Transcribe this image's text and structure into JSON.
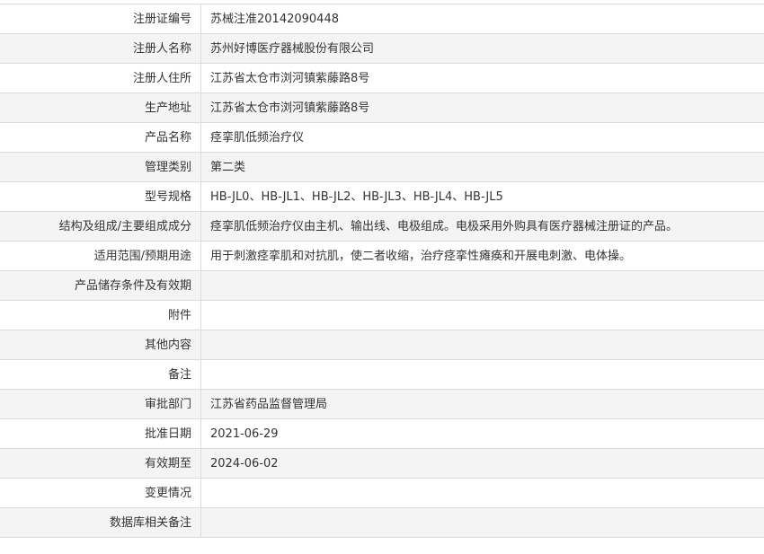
{
  "record": {
    "rows": [
      {
        "label": "注册证编号",
        "value": "苏械注准20142090448"
      },
      {
        "label": "注册人名称",
        "value": "苏州好博医疗器械股份有限公司"
      },
      {
        "label": "注册人住所",
        "value": "江苏省太仓市浏河镇紫藤路8号"
      },
      {
        "label": "生产地址",
        "value": "江苏省太仓市浏河镇紫藤路8号"
      },
      {
        "label": "产品名称",
        "value": "痉挛肌低频治疗仪"
      },
      {
        "label": "管理类别",
        "value": "第二类"
      },
      {
        "label": "型号规格",
        "value": "HB-JL0、HB-JL1、HB-JL2、HB-JL3、HB-JL4、HB-JL5"
      },
      {
        "label": "结构及组成/主要组成成分",
        "value": "痉挛肌低频治疗仪由主机、输出线、电极组成。电极采用外购具有医疗器械注册证的产品。"
      },
      {
        "label": "适用范围/预期用途",
        "value": "用于刺激痉挛肌和对抗肌，使二者收缩，治疗痉挛性瘫痪和开展电刺激、电体操。"
      },
      {
        "label": "产品储存条件及有效期",
        "value": ""
      },
      {
        "label": "附件",
        "value": ""
      },
      {
        "label": "其他内容",
        "value": ""
      },
      {
        "label": "备注",
        "value": ""
      },
      {
        "label": "审批部门",
        "value": "江苏省药品监督管理局"
      },
      {
        "label": "批准日期",
        "value": "2021-06-29"
      },
      {
        "label": "有效期至",
        "value": "2024-06-02"
      },
      {
        "label": "变更情况",
        "value": ""
      },
      {
        "label": "数据库相关备注",
        "value": ""
      }
    ]
  },
  "colors": {
    "border": "#dcdcdc",
    "alt_row_background": "#f4f4f4",
    "text": "#333333"
  }
}
